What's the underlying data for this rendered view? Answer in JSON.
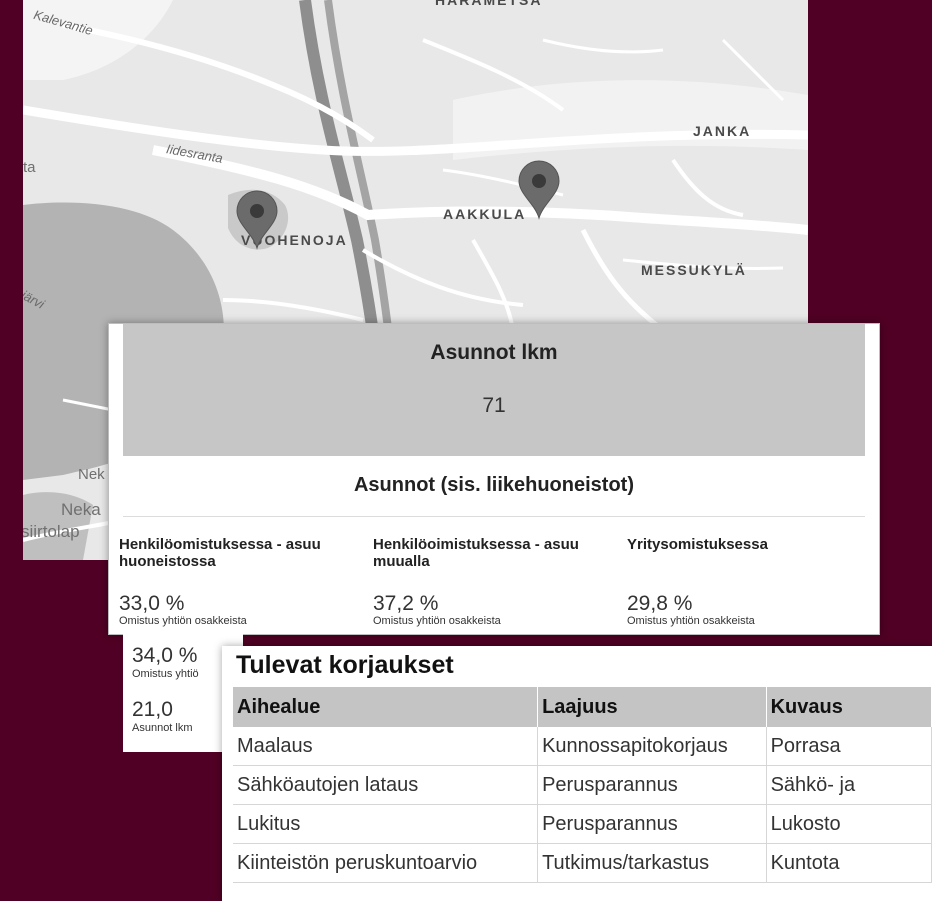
{
  "map": {
    "labels": {
      "harametsa": "HARAMETSÄ",
      "kalevantie": "Kalevantie",
      "iidesranta": "Iidesranta",
      "ta": "ta",
      "janka": "JANKA",
      "aakkula": "AAKKULA",
      "vuohenoja": "VUOHENOJA",
      "messukyla": "MESSUKYLÄ",
      "jarvi": "järvi",
      "nek": "Nek",
      "neka": "Neka",
      "siirtolap": "siirtolap"
    },
    "pins": [
      {
        "name": "location-pin-vuohenoja"
      },
      {
        "name": "location-pin-aakkula"
      }
    ]
  },
  "asunnot": {
    "title": "Asunnot lkm",
    "count": "71",
    "section_title": "Asunnot (sis. liikehuoneistot)",
    "columns": [
      {
        "head": "Henkilöomistuksessa - asuu huoneistossa",
        "pct": "33,0 %",
        "sub": "Omistus yhtiön osakkeista"
      },
      {
        "head": "Henkilöoimistuksessa - asuu muualla",
        "pct": "37,2 %",
        "sub": "Omistus yhtiön osakkeista"
      },
      {
        "head": "Yritysomistuksessa",
        "pct": "29,8 %",
        "sub": "Omistus yhtiön osakkeista"
      }
    ]
  },
  "extra_stats": [
    {
      "value": "34,0 %",
      "sub": "Omistus yhtiö"
    },
    {
      "value": "21,0",
      "sub": "Asunnot lkm"
    }
  ],
  "korjaukset": {
    "title": "Tulevat korjaukset",
    "headers": [
      "Aihealue",
      "Laajuus",
      "Kuvaus"
    ],
    "rows": [
      [
        "Maalaus",
        "Kunnossapitokorjaus",
        "Porrasa"
      ],
      [
        "Sähköautojen lataus",
        "Perusparannus",
        "Sähkö- ja"
      ],
      [
        "Lukitus",
        "Perusparannus",
        "Lukosto"
      ],
      [
        "Kiinteistön peruskuntoarvio",
        "Tutkimus/tarkastus",
        "Kuntota"
      ]
    ]
  }
}
